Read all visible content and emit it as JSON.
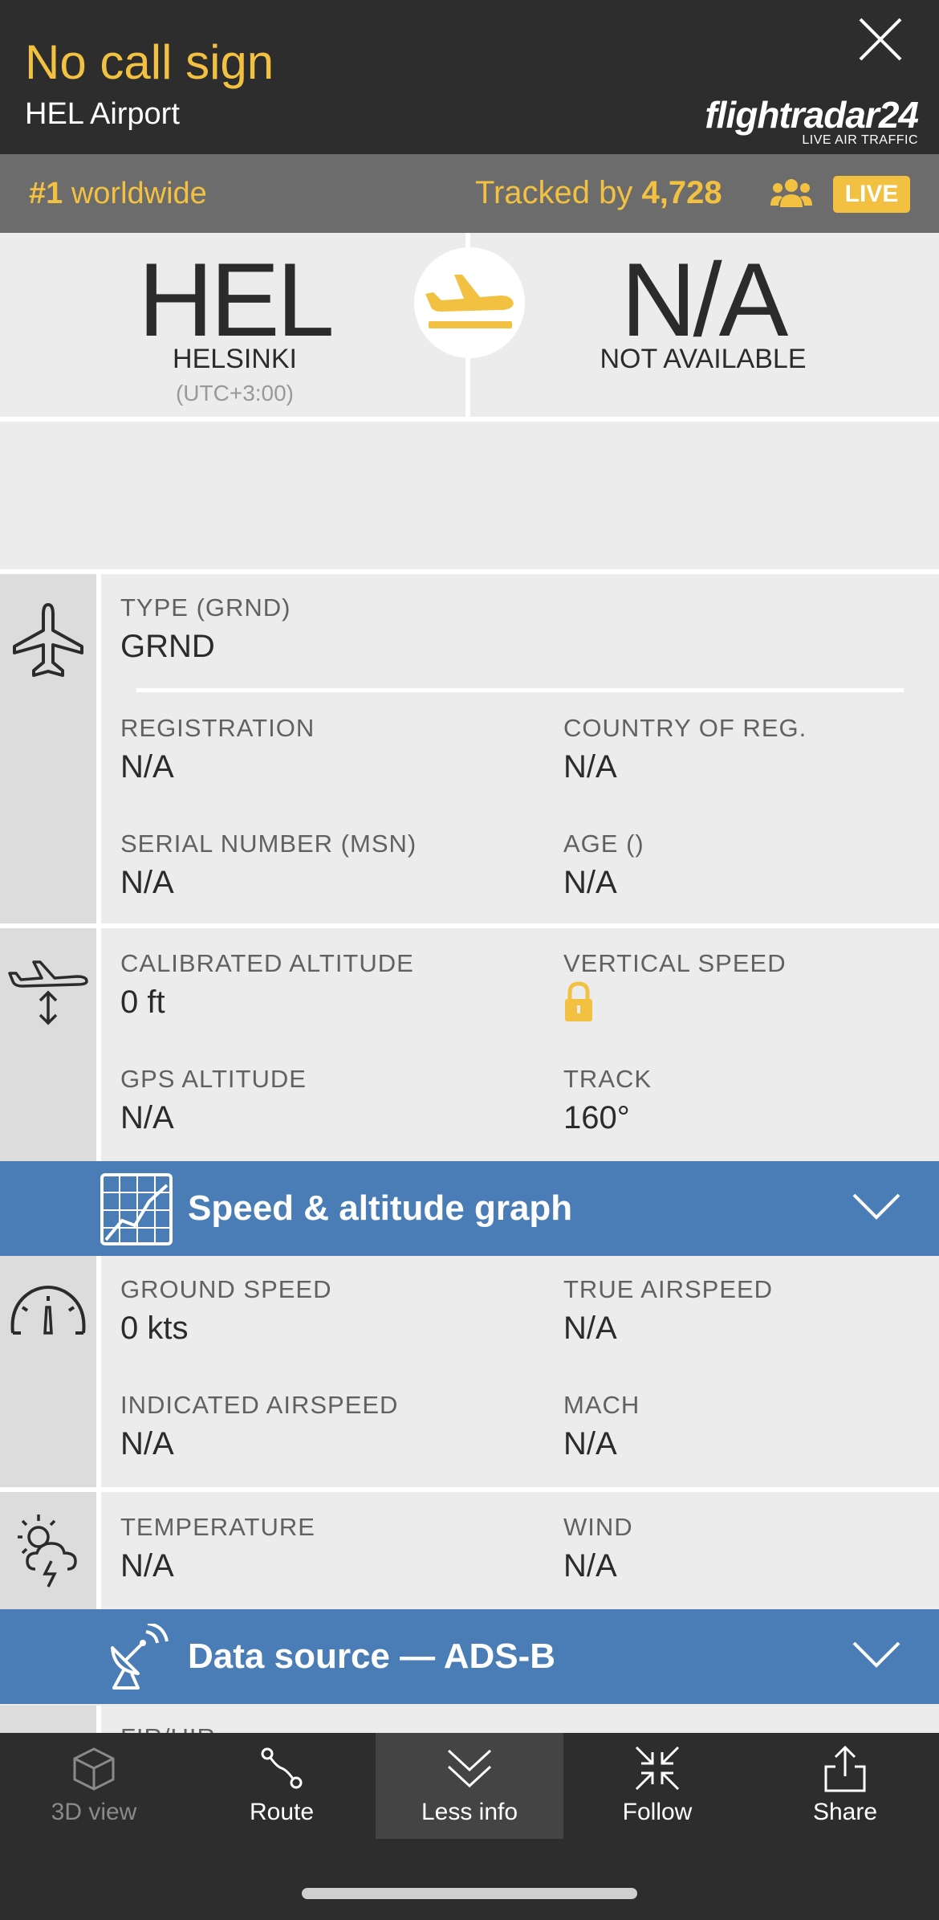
{
  "header": {
    "callsign": "No call sign",
    "airport": "HEL Airport",
    "brand_name": "flightradar24",
    "brand_tagline": "LIVE AIR TRAFFIC"
  },
  "tracking": {
    "rank_number": "#1",
    "rank_text": "worldwide",
    "tracked_prefix": "Tracked by",
    "tracked_count": "4,728",
    "live_label": "LIVE"
  },
  "route": {
    "origin": {
      "code": "HEL",
      "city": "HELSINKI",
      "timezone": "(UTC+3:00)"
    },
    "destination": {
      "code": "N/A",
      "city": "NOT AVAILABLE"
    }
  },
  "aircraft": {
    "type_label": "TYPE (GRND)",
    "type_value": "GRND",
    "registration_label": "REGISTRATION",
    "registration_value": "N/A",
    "country_label": "COUNTRY OF REG.",
    "country_value": "N/A",
    "serial_label": "SERIAL NUMBER (MSN)",
    "serial_value": "N/A",
    "age_label": "AGE ()",
    "age_value": "N/A"
  },
  "altitude": {
    "calibrated_label": "CALIBRATED ALTITUDE",
    "calibrated_value": "0 ft",
    "vertical_speed_label": "VERTICAL SPEED",
    "gps_label": "GPS ALTITUDE",
    "gps_value": "N/A",
    "track_label": "TRACK",
    "track_value": "160°"
  },
  "graph_bar": {
    "title": "Speed & altitude graph"
  },
  "speed": {
    "ground_label": "GROUND SPEED",
    "ground_value": "0 kts",
    "true_label": "TRUE AIRSPEED",
    "true_value": "N/A",
    "indicated_label": "INDICATED AIRSPEED",
    "indicated_value": "N/A",
    "mach_label": "MACH",
    "mach_value": "N/A"
  },
  "weather": {
    "temperature_label": "TEMPERATURE",
    "temperature_value": "N/A",
    "wind_label": "WIND",
    "wind_value": "N/A"
  },
  "source_bar": {
    "title": "Data source — ADS-B"
  },
  "peek_label": "FIR/UIR",
  "bottom_nav": [
    {
      "label": "3D view",
      "icon": "cube-icon"
    },
    {
      "label": "Route",
      "icon": "route-icon"
    },
    {
      "label": "Less info",
      "icon": "chevron-down-icon"
    },
    {
      "label": "Follow",
      "icon": "follow-icon"
    },
    {
      "label": "Share",
      "icon": "share-icon"
    }
  ],
  "colors": {
    "accent_yellow": "#f2c141",
    "header_bg": "#2d2d2d",
    "bar_blue": "#4a7db5",
    "track_bar_bg": "#6c6c6c"
  }
}
